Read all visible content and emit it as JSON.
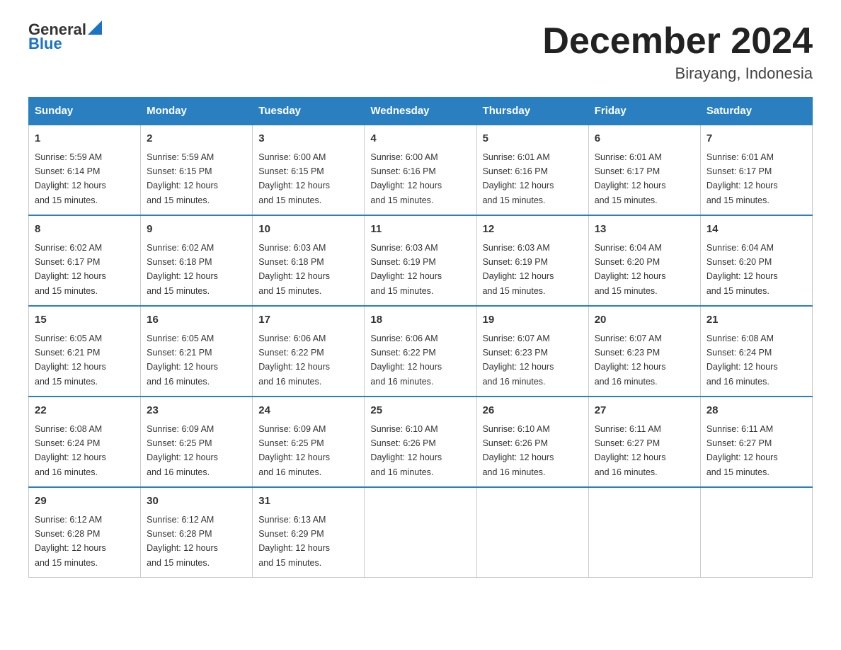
{
  "header": {
    "logo_general": "General",
    "logo_blue": "Blue",
    "month_title": "December 2024",
    "location": "Birayang, Indonesia"
  },
  "weekdays": [
    "Sunday",
    "Monday",
    "Tuesday",
    "Wednesday",
    "Thursday",
    "Friday",
    "Saturday"
  ],
  "weeks": [
    [
      {
        "day": "1",
        "sunrise": "5:59 AM",
        "sunset": "6:14 PM",
        "daylight": "12 hours and 15 minutes."
      },
      {
        "day": "2",
        "sunrise": "5:59 AM",
        "sunset": "6:15 PM",
        "daylight": "12 hours and 15 minutes."
      },
      {
        "day": "3",
        "sunrise": "6:00 AM",
        "sunset": "6:15 PM",
        "daylight": "12 hours and 15 minutes."
      },
      {
        "day": "4",
        "sunrise": "6:00 AM",
        "sunset": "6:16 PM",
        "daylight": "12 hours and 15 minutes."
      },
      {
        "day": "5",
        "sunrise": "6:01 AM",
        "sunset": "6:16 PM",
        "daylight": "12 hours and 15 minutes."
      },
      {
        "day": "6",
        "sunrise": "6:01 AM",
        "sunset": "6:17 PM",
        "daylight": "12 hours and 15 minutes."
      },
      {
        "day": "7",
        "sunrise": "6:01 AM",
        "sunset": "6:17 PM",
        "daylight": "12 hours and 15 minutes."
      }
    ],
    [
      {
        "day": "8",
        "sunrise": "6:02 AM",
        "sunset": "6:17 PM",
        "daylight": "12 hours and 15 minutes."
      },
      {
        "day": "9",
        "sunrise": "6:02 AM",
        "sunset": "6:18 PM",
        "daylight": "12 hours and 15 minutes."
      },
      {
        "day": "10",
        "sunrise": "6:03 AM",
        "sunset": "6:18 PM",
        "daylight": "12 hours and 15 minutes."
      },
      {
        "day": "11",
        "sunrise": "6:03 AM",
        "sunset": "6:19 PM",
        "daylight": "12 hours and 15 minutes."
      },
      {
        "day": "12",
        "sunrise": "6:03 AM",
        "sunset": "6:19 PM",
        "daylight": "12 hours and 15 minutes."
      },
      {
        "day": "13",
        "sunrise": "6:04 AM",
        "sunset": "6:20 PM",
        "daylight": "12 hours and 15 minutes."
      },
      {
        "day": "14",
        "sunrise": "6:04 AM",
        "sunset": "6:20 PM",
        "daylight": "12 hours and 15 minutes."
      }
    ],
    [
      {
        "day": "15",
        "sunrise": "6:05 AM",
        "sunset": "6:21 PM",
        "daylight": "12 hours and 15 minutes."
      },
      {
        "day": "16",
        "sunrise": "6:05 AM",
        "sunset": "6:21 PM",
        "daylight": "12 hours and 16 minutes."
      },
      {
        "day": "17",
        "sunrise": "6:06 AM",
        "sunset": "6:22 PM",
        "daylight": "12 hours and 16 minutes."
      },
      {
        "day": "18",
        "sunrise": "6:06 AM",
        "sunset": "6:22 PM",
        "daylight": "12 hours and 16 minutes."
      },
      {
        "day": "19",
        "sunrise": "6:07 AM",
        "sunset": "6:23 PM",
        "daylight": "12 hours and 16 minutes."
      },
      {
        "day": "20",
        "sunrise": "6:07 AM",
        "sunset": "6:23 PM",
        "daylight": "12 hours and 16 minutes."
      },
      {
        "day": "21",
        "sunrise": "6:08 AM",
        "sunset": "6:24 PM",
        "daylight": "12 hours and 16 minutes."
      }
    ],
    [
      {
        "day": "22",
        "sunrise": "6:08 AM",
        "sunset": "6:24 PM",
        "daylight": "12 hours and 16 minutes."
      },
      {
        "day": "23",
        "sunrise": "6:09 AM",
        "sunset": "6:25 PM",
        "daylight": "12 hours and 16 minutes."
      },
      {
        "day": "24",
        "sunrise": "6:09 AM",
        "sunset": "6:25 PM",
        "daylight": "12 hours and 16 minutes."
      },
      {
        "day": "25",
        "sunrise": "6:10 AM",
        "sunset": "6:26 PM",
        "daylight": "12 hours and 16 minutes."
      },
      {
        "day": "26",
        "sunrise": "6:10 AM",
        "sunset": "6:26 PM",
        "daylight": "12 hours and 16 minutes."
      },
      {
        "day": "27",
        "sunrise": "6:11 AM",
        "sunset": "6:27 PM",
        "daylight": "12 hours and 16 minutes."
      },
      {
        "day": "28",
        "sunrise": "6:11 AM",
        "sunset": "6:27 PM",
        "daylight": "12 hours and 15 minutes."
      }
    ],
    [
      {
        "day": "29",
        "sunrise": "6:12 AM",
        "sunset": "6:28 PM",
        "daylight": "12 hours and 15 minutes."
      },
      {
        "day": "30",
        "sunrise": "6:12 AM",
        "sunset": "6:28 PM",
        "daylight": "12 hours and 15 minutes."
      },
      {
        "day": "31",
        "sunrise": "6:13 AM",
        "sunset": "6:29 PM",
        "daylight": "12 hours and 15 minutes."
      },
      null,
      null,
      null,
      null
    ]
  ],
  "labels": {
    "sunrise_prefix": "Sunrise: ",
    "sunset_prefix": "Sunset: ",
    "daylight_prefix": "Daylight: "
  }
}
